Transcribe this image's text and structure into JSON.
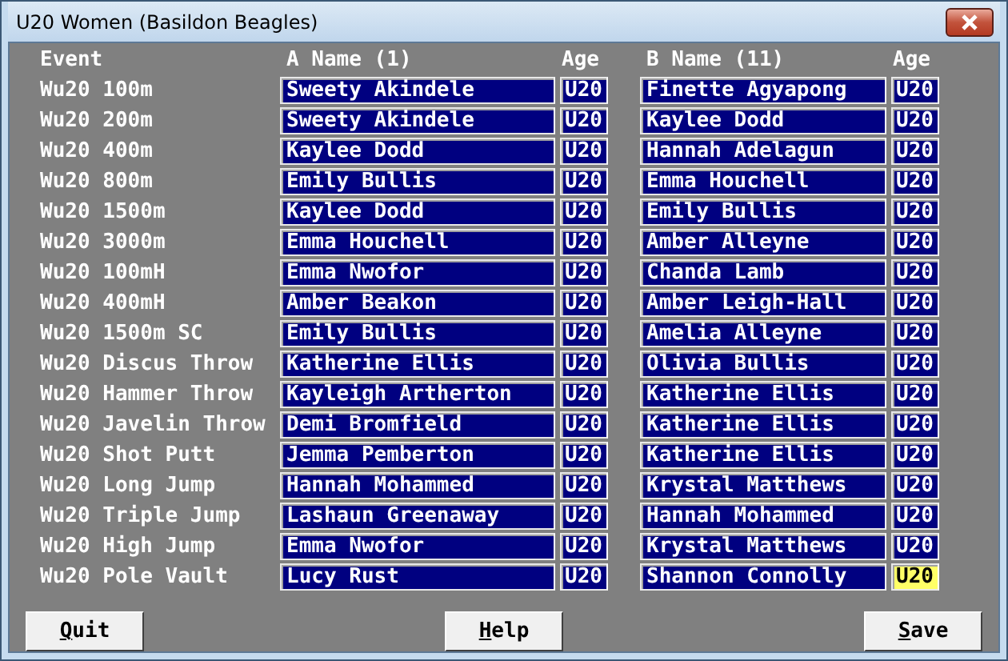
{
  "window": {
    "title": "U20 Women (Basildon Beagles)"
  },
  "columns": [
    "Event",
    "A Name (1)",
    "Age",
    "B Name (11)",
    "Age"
  ],
  "rows": [
    {
      "event": "Wu20 100m",
      "a_name": "Sweety Akindele",
      "a_age": "U20",
      "b_name": "Finette Agyapong",
      "b_age": "U20",
      "b_age_focused": false
    },
    {
      "event": "Wu20 200m",
      "a_name": "Sweety Akindele",
      "a_age": "U20",
      "b_name": "Kaylee Dodd",
      "b_age": "U20",
      "b_age_focused": false
    },
    {
      "event": "Wu20 400m",
      "a_name": "Kaylee Dodd",
      "a_age": "U20",
      "b_name": "Hannah Adelagun",
      "b_age": "U20",
      "b_age_focused": false
    },
    {
      "event": "Wu20 800m",
      "a_name": "Emily Bullis",
      "a_age": "U20",
      "b_name": "Emma Houchell",
      "b_age": "U20",
      "b_age_focused": false
    },
    {
      "event": "Wu20 1500m",
      "a_name": "Kaylee Dodd",
      "a_age": "U20",
      "b_name": "Emily Bullis",
      "b_age": "U20",
      "b_age_focused": false
    },
    {
      "event": "Wu20 3000m",
      "a_name": "Emma Houchell",
      "a_age": "U20",
      "b_name": "Amber Alleyne",
      "b_age": "U20",
      "b_age_focused": false
    },
    {
      "event": "Wu20 100mH",
      "a_name": "Emma Nwofor",
      "a_age": "U20",
      "b_name": "Chanda Lamb",
      "b_age": "U20",
      "b_age_focused": false
    },
    {
      "event": "Wu20 400mH",
      "a_name": "Amber Beakon",
      "a_age": "U20",
      "b_name": "Amber Leigh-Hall",
      "b_age": "U20",
      "b_age_focused": false
    },
    {
      "event": "Wu20 1500m SC",
      "a_name": "Emily Bullis",
      "a_age": "U20",
      "b_name": "Amelia Alleyne",
      "b_age": "U20",
      "b_age_focused": false
    },
    {
      "event": "Wu20 Discus Throw",
      "a_name": "Katherine Ellis",
      "a_age": "U20",
      "b_name": "Olivia Bullis",
      "b_age": "U20",
      "b_age_focused": false
    },
    {
      "event": "Wu20 Hammer Throw",
      "a_name": "Kayleigh Artherton",
      "a_age": "U20",
      "b_name": "Katherine Ellis",
      "b_age": "U20",
      "b_age_focused": false
    },
    {
      "event": "Wu20 Javelin Throw",
      "a_name": "Demi Bromfield",
      "a_age": "U20",
      "b_name": "Katherine Ellis",
      "b_age": "U20",
      "b_age_focused": false
    },
    {
      "event": "Wu20 Shot Putt",
      "a_name": "Jemma Pemberton",
      "a_age": "U20",
      "b_name": "Katherine Ellis",
      "b_age": "U20",
      "b_age_focused": false
    },
    {
      "event": "Wu20 Long Jump",
      "a_name": "Hannah Mohammed",
      "a_age": "U20",
      "b_name": "Krystal Matthews",
      "b_age": "U20",
      "b_age_focused": false
    },
    {
      "event": "Wu20 Triple Jump",
      "a_name": "Lashaun Greenaway",
      "a_age": "U20",
      "b_name": "Hannah Mohammed",
      "b_age": "U20",
      "b_age_focused": false
    },
    {
      "event": "Wu20 High Jump",
      "a_name": "Emma Nwofor",
      "a_age": "U20",
      "b_name": "Krystal Matthews",
      "b_age": "U20",
      "b_age_focused": false
    },
    {
      "event": "Wu20 Pole Vault",
      "a_name": "Lucy Rust",
      "a_age": "U20",
      "b_name": "Shannon Connolly",
      "b_age": "U20",
      "b_age_focused": true
    }
  ],
  "buttons": [
    {
      "label": "Quit",
      "first_letter_underlined": true
    },
    {
      "label": "Help",
      "first_letter_underlined": true
    },
    {
      "label": "Save",
      "first_letter_underlined": true
    }
  ]
}
